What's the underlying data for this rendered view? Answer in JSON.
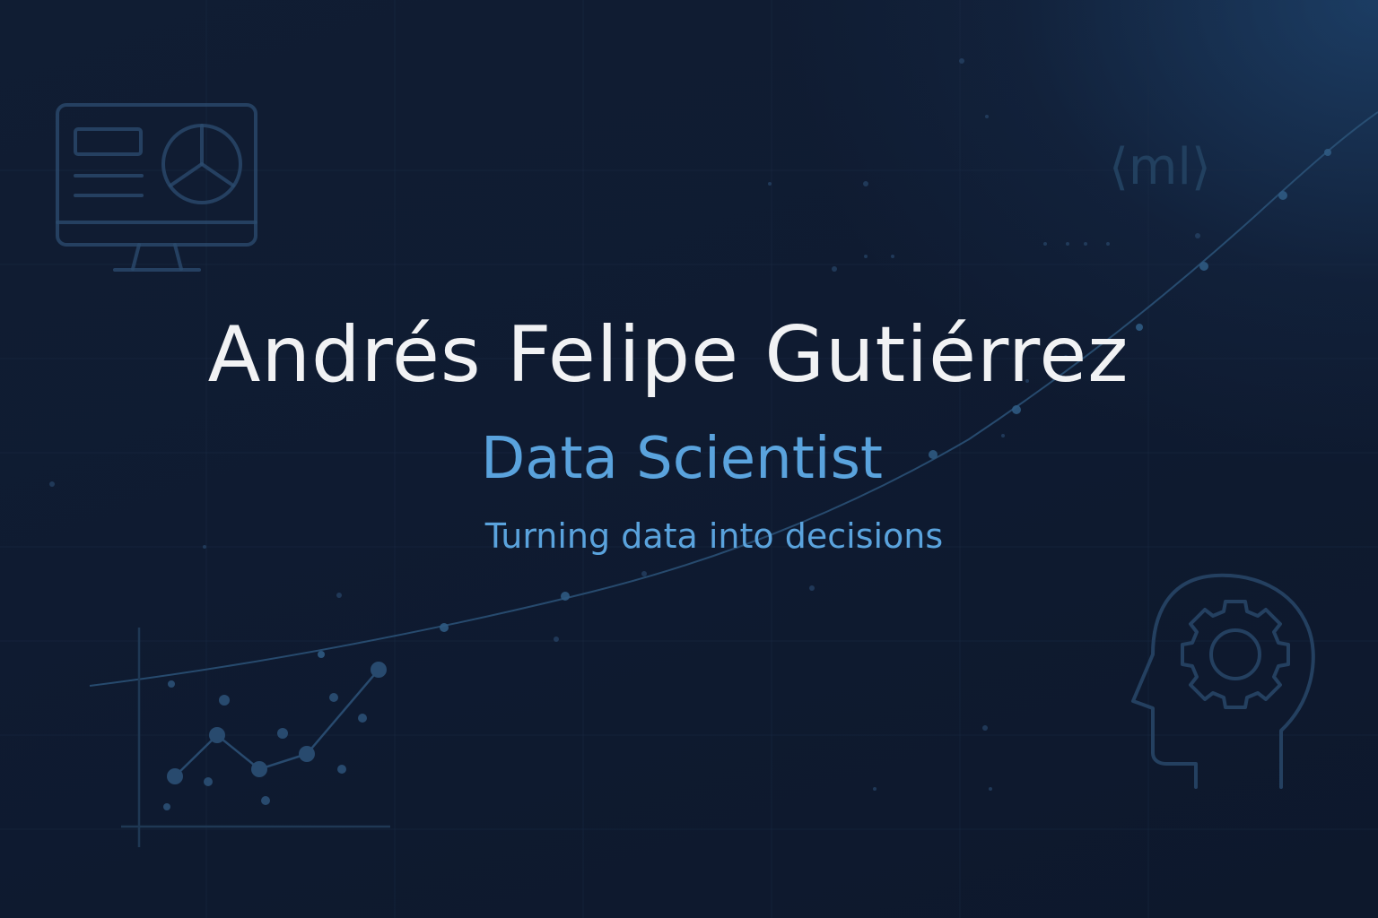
{
  "profile": {
    "name": "Andrés Felipe Gutiérrez",
    "role": "Data Scientist",
    "tagline": "Turning data into decisions"
  },
  "decorations": {
    "code_tag": "⟨ml⟩",
    "icons": [
      "dashboard-monitor-icon",
      "ml-code-tag-icon",
      "scatter-plot-icon",
      "head-gear-icon"
    ]
  },
  "colors": {
    "background": "#0f1a2e",
    "headline": "#f1f2f4",
    "accent": "#5aa3dd",
    "decoration": "#2b4a6d"
  }
}
